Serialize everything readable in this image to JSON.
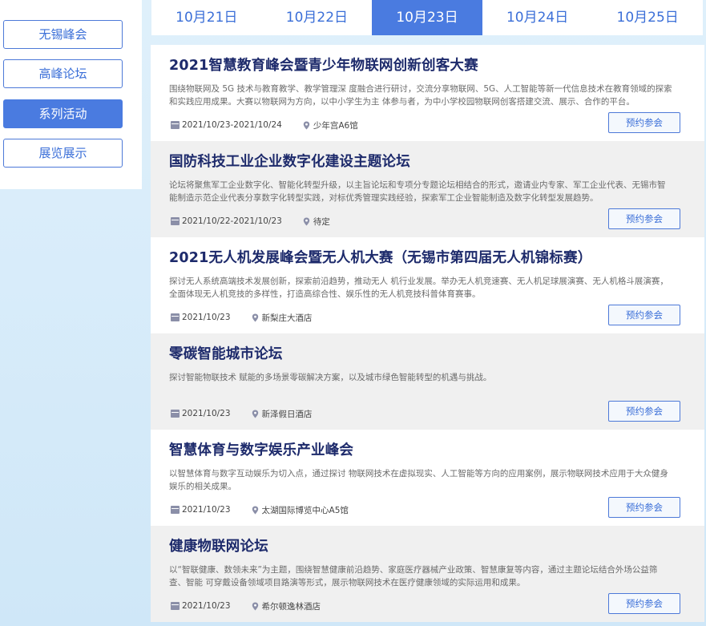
{
  "sidebar": {
    "items": [
      {
        "label": "无锡峰会"
      },
      {
        "label": "高峰论坛"
      },
      {
        "label": "系列活动",
        "active": true
      },
      {
        "label": "展览展示"
      }
    ]
  },
  "dates": [
    {
      "label": "10月21日"
    },
    {
      "label": "10月22日"
    },
    {
      "label": "10月23日",
      "active": true
    },
    {
      "label": "10月24日"
    },
    {
      "label": "10月25日"
    }
  ],
  "events": [
    {
      "title": "2021智慧教育峰会暨青少年物联网创新创客大赛",
      "desc": "围绕物联网及 5G 技术与教育教学、教学管理深 度融合进行研讨，交流分享物联网、5G、人工智能等新一代信息技术在教育领域的探索和实践应用成果。大赛以物联网为方向，以中小学生为主 体参与者，为中小学校园物联网创客搭建交流、展示、合作的平台。",
      "date": "2021/10/23-2021/10/24",
      "location": "少年宫A6馆",
      "button": "预约参会"
    },
    {
      "title": "国防科技工业企业数字化建设主题论坛",
      "desc": "论坛将聚焦军工企业数字化、智能化转型升级，以主旨论坛和专项分专题论坛相结合的形式，邀请业内专家、军工企业代表、无锡市智能制造示范企业代表分享数字化转型实践，对标优秀管理实践经验，探索军工企业智能制造及数字化转型发展趋势。",
      "date": "2021/10/22-2021/10/23",
      "location": "待定",
      "button": "预约参会"
    },
    {
      "title": "2021无人机发展峰会暨无人机大赛（无锡市第四届无人机锦标赛）",
      "desc": "探讨无人系统高端技术发展创新，探索前沿趋势，推动无人 机行业发展。举办无人机竞速赛、无人机足球展演赛、无人机格斗展演赛，全面体现无人机竞技的多样性，打造高综合性、娱乐性的无人机竞技科普体育赛事。",
      "date": "2021/10/23",
      "location": "新梨庄大酒店",
      "button": "预约参会"
    },
    {
      "title": "零碳智能城市论坛",
      "desc": "探讨智能物联技术 赋能的多场景零碳解决方案，以及城市绿色智能转型的机遇与挑战。",
      "date": "2021/10/23",
      "location": "新泽假日酒店",
      "button": "预约参会"
    },
    {
      "title": "智慧体育与数字娱乐产业峰会",
      "desc": "以智慧体育与数字互动娱乐为切入点，通过探讨 物联网技术在虚拟现实、人工智能等方向的应用案例，展示物联网技术应用于大众健身娱乐的相关成果。",
      "date": "2021/10/23",
      "location": "太湖国际博览中心A5馆",
      "button": "预约参会"
    },
    {
      "title": "健康物联网论坛",
      "desc": "以“智联健康、数领未来”为主题，围绕智慧健康前沿趋势、家庭医疗器械产业政策、智慧康复等内容，通过主题论坛结合外场公益筛查、智能 可穿戴设备领域项目路演等形式，展示物联网技术在医疗健康领域的实际运用和成果。",
      "date": "2021/10/23",
      "location": "希尔顿逸林酒店",
      "button": "预约参会"
    }
  ]
}
